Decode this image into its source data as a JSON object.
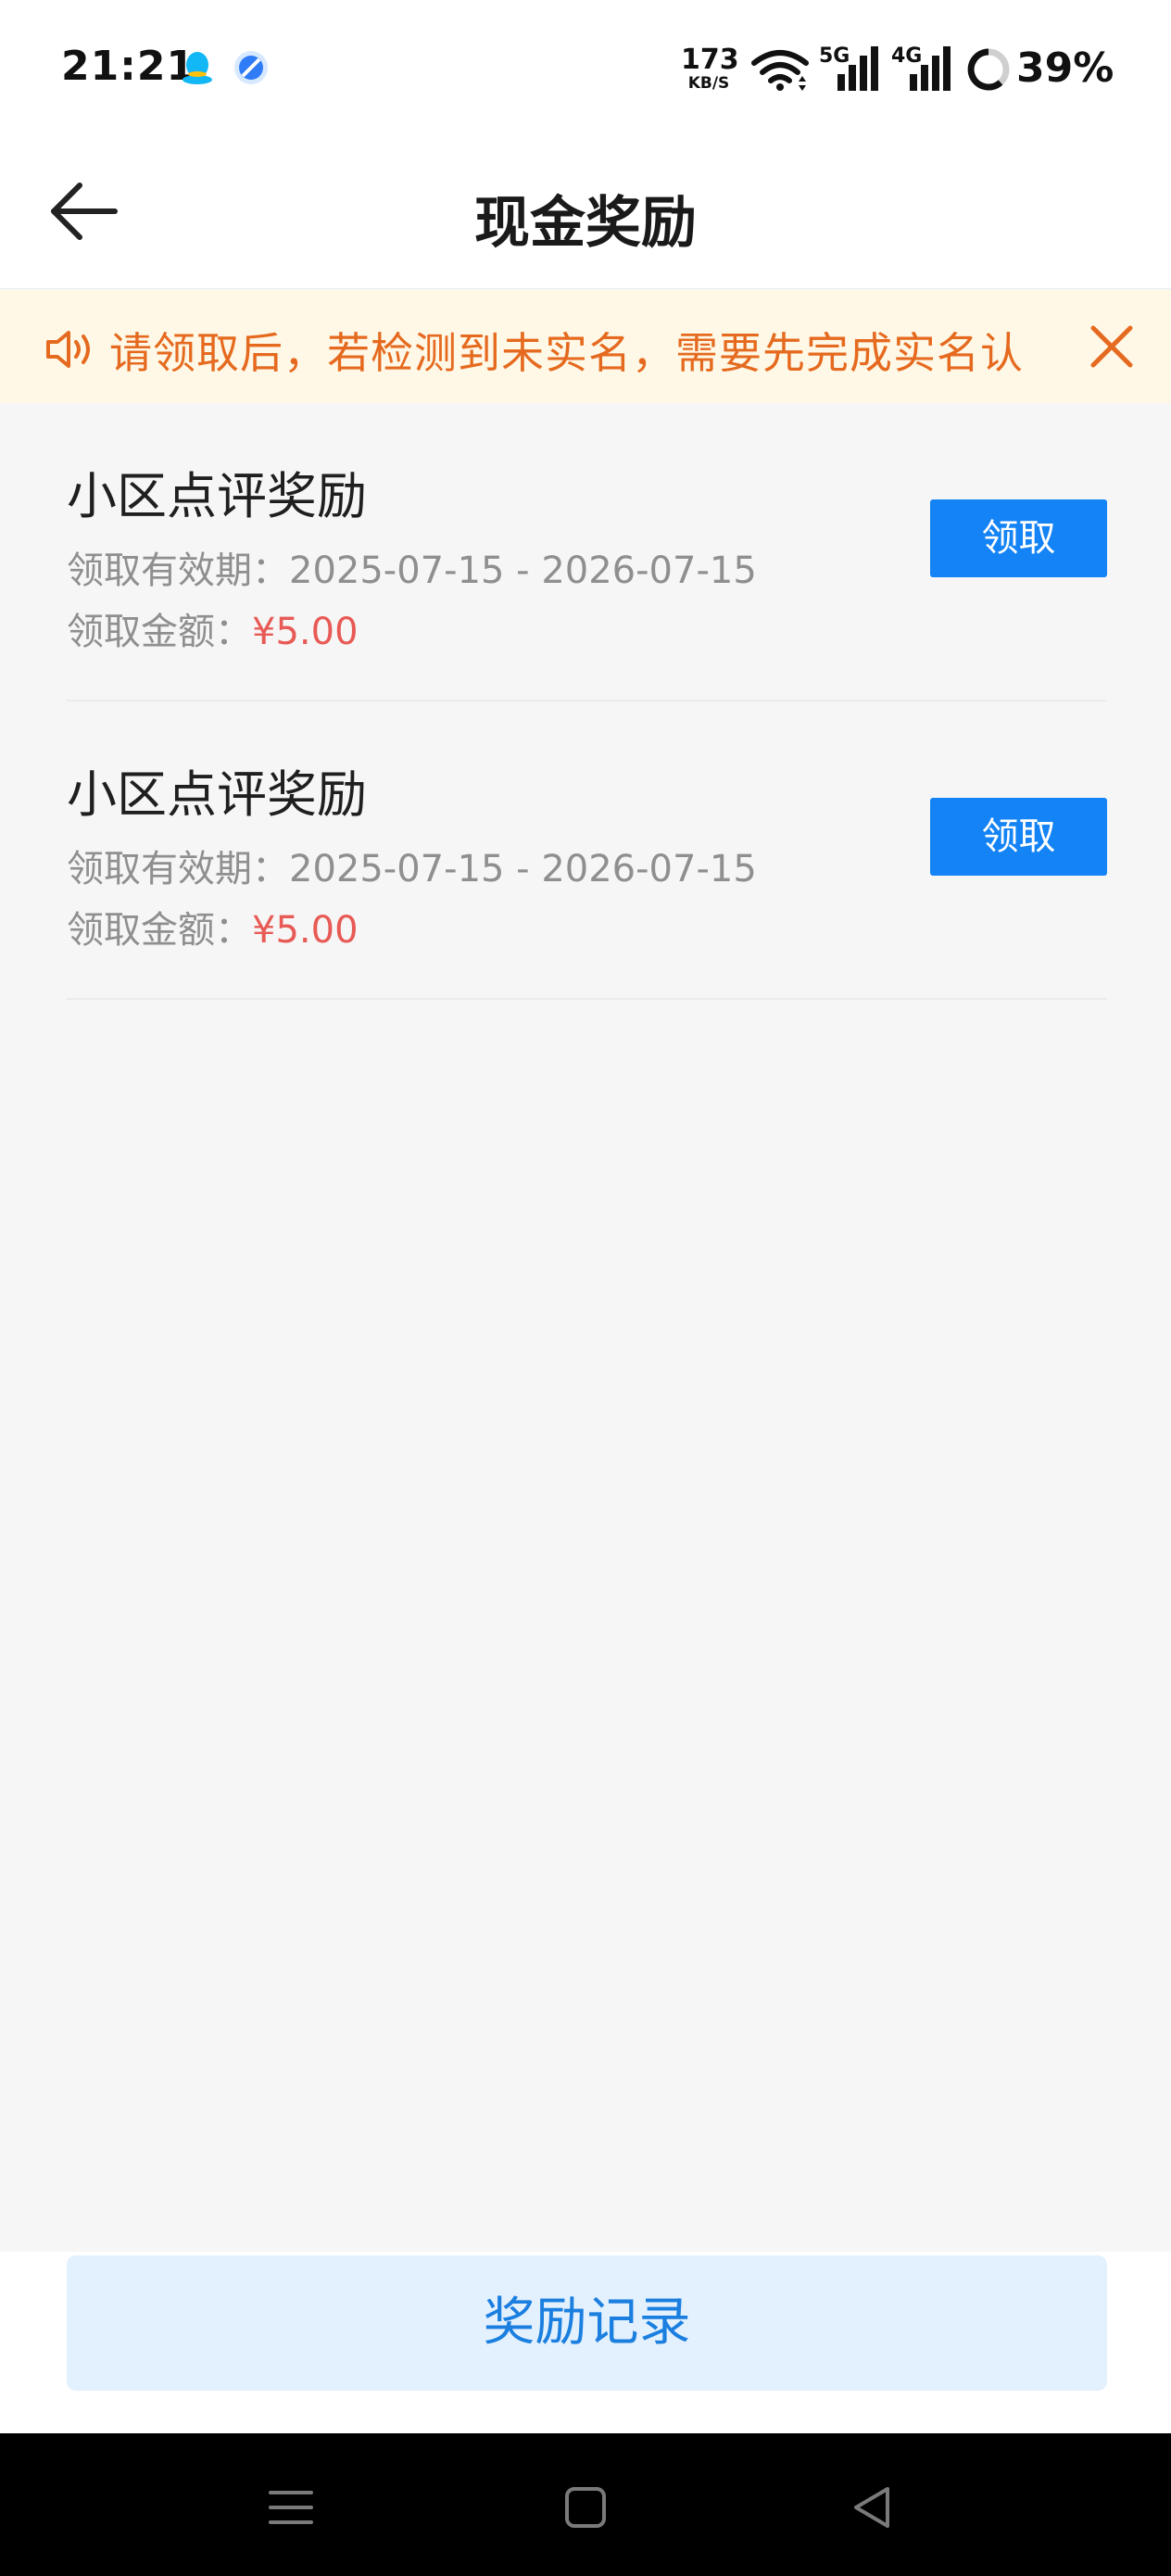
{
  "status_bar": {
    "time": "21:21",
    "net_speed_value": "173",
    "net_speed_unit": "KB/S",
    "network_5g": "5G",
    "network_4g": "4G",
    "battery": "39%",
    "icons": [
      "qq-icon",
      "browser-icon",
      "wifi-icon",
      "signal-5g-icon",
      "signal-4g-icon",
      "battery-ring-icon"
    ]
  },
  "header": {
    "title": "现金奖励",
    "back_icon": "arrow-left-icon"
  },
  "notice": {
    "text": "请领取后，若检测到未实名，需要先完成实名认",
    "icon": "speaker-icon",
    "close_icon": "close-icon",
    "color": "#e56a1f",
    "background": "#fff8e6"
  },
  "rewards": [
    {
      "title": "小区点评奖励",
      "validity_label": "领取有效期：",
      "validity": "2025-07-15 - 2026-07-15",
      "amount_label": "领取金额：",
      "amount": "¥5.00",
      "button": "领取"
    },
    {
      "title": "小区点评奖励",
      "validity_label": "领取有效期：",
      "validity": "2025-07-15 - 2026-07-15",
      "amount_label": "领取金额：",
      "amount": "¥5.00",
      "button": "领取"
    }
  ],
  "bottom": {
    "records_button": "奖励记录"
  },
  "nav_bar": {
    "icons": [
      "menu-icon",
      "home-icon",
      "back-triangle-icon"
    ]
  },
  "colors": {
    "accent": "#1383f5",
    "amount": "#e85a55",
    "records_bg": "#e3f0fd",
    "records_text": "#1b7fe0"
  }
}
